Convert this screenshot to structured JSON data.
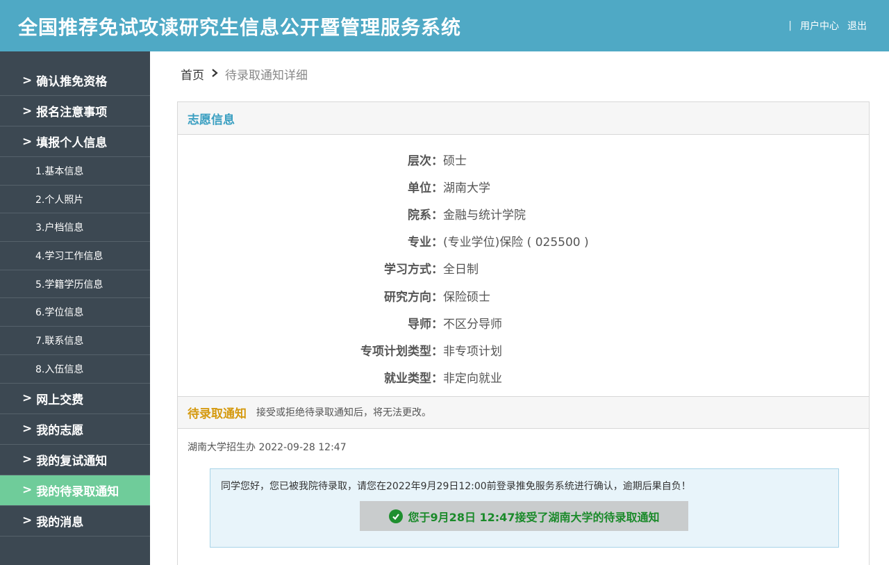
{
  "header": {
    "title": "全国推荐免试攻读研究生信息公开暨管理服务系统",
    "separator": "|",
    "user_center": "用户中心",
    "logout": "退出"
  },
  "sidebar": {
    "chevron": ">",
    "items": [
      {
        "label": "确认推免资格",
        "type": "main"
      },
      {
        "label": "报名注意事项",
        "type": "main"
      },
      {
        "label": "填报个人信息",
        "type": "main"
      },
      {
        "label": "1.基本信息",
        "type": "sub"
      },
      {
        "label": "2.个人照片",
        "type": "sub"
      },
      {
        "label": "3.户档信息",
        "type": "sub"
      },
      {
        "label": "4.学习工作信息",
        "type": "sub"
      },
      {
        "label": "5.学籍学历信息",
        "type": "sub"
      },
      {
        "label": "6.学位信息",
        "type": "sub"
      },
      {
        "label": "7.联系信息",
        "type": "sub"
      },
      {
        "label": "8.入伍信息",
        "type": "sub"
      },
      {
        "label": "网上交费",
        "type": "main"
      },
      {
        "label": "我的志愿",
        "type": "main"
      },
      {
        "label": "我的复试通知",
        "type": "main"
      },
      {
        "label": "我的待录取通知",
        "type": "main",
        "active": true
      },
      {
        "label": "我的消息",
        "type": "main"
      }
    ]
  },
  "breadcrumb": {
    "home": "首页",
    "current": "待录取通知详细"
  },
  "panel": {
    "title": "志愿信息",
    "rows": [
      {
        "label": "层次：",
        "value": "硕士"
      },
      {
        "label": "单位：",
        "value": "湖南大学"
      },
      {
        "label": "院系：",
        "value": "金融与统计学院"
      },
      {
        "label": "专业：",
        "value": "(专业学位)保险 ( 025500 )"
      },
      {
        "label": "学习方式：",
        "value": "全日制"
      },
      {
        "label": "研究方向：",
        "value": "保险硕士"
      },
      {
        "label": "导师：",
        "value": "不区分导师"
      },
      {
        "label": "专项计划类型：",
        "value": "非专项计划"
      },
      {
        "label": "就业类型：",
        "value": "非定向就业"
      }
    ]
  },
  "notice": {
    "title": "待录取通知",
    "description": "接受或拒绝待录取通知后，将无法更改。",
    "sender": "湖南大学招生办 2022-09-28 12:47",
    "message": "同学您好，您已被我院待录取，请您在2022年9月29日12:00前登录推免服务系统进行确认，逾期后果自负！",
    "accepted_text": "您于9月28日 12:47接受了湖南大学的待录取通知"
  },
  "colors": {
    "header_bg": "#4fa9c5",
    "sidebar_bg": "#3c4852",
    "sidebar_active": "#6fcc9a",
    "accent_title": "#3a9fc1",
    "notice_title": "#d59a10",
    "success": "#1a8a2a"
  }
}
